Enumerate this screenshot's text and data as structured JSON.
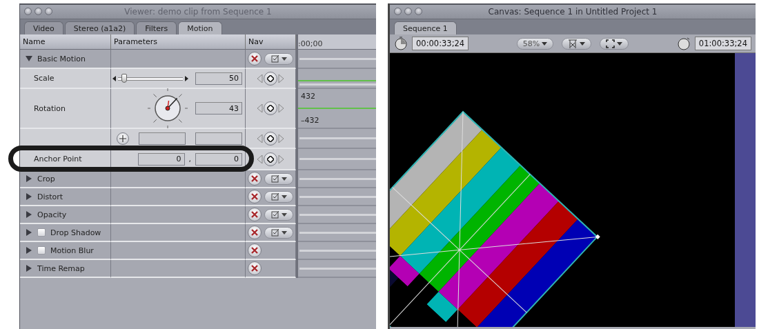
{
  "viewer": {
    "title": "Viewer: demo clip from Sequence 1",
    "tabs": [
      {
        "label": "Video",
        "selected": false
      },
      {
        "label": "Stereo (a1a2)",
        "selected": false
      },
      {
        "label": "Filters",
        "selected": false
      },
      {
        "label": "Motion",
        "selected": true
      }
    ],
    "columns": [
      "Name",
      "Parameters",
      "Nav"
    ],
    "timeline_start": ":00;00",
    "rows": [
      {
        "kind": "group",
        "label": "Basic Motion",
        "expanded": true,
        "menu": true
      },
      {
        "kind": "slider",
        "label": "Scale",
        "level": 0.1,
        "value": "50"
      },
      {
        "kind": "dial",
        "label": "Rotation",
        "value": "43",
        "graph_labels": [
          "432",
          "–432"
        ]
      },
      {
        "kind": "point",
        "crosshair": true
      },
      {
        "kind": "point",
        "label": "Anchor Point",
        "values": [
          "0",
          "0"
        ],
        "separator": ","
      },
      {
        "kind": "group",
        "label": "Crop",
        "expanded": false,
        "menu": true
      },
      {
        "kind": "group",
        "label": "Distort",
        "expanded": false,
        "menu": true
      },
      {
        "kind": "group",
        "label": "Opacity",
        "expanded": false,
        "menu": true
      },
      {
        "kind": "group",
        "label": "Drop Shadow",
        "expanded": false,
        "menu": true,
        "checked": false
      },
      {
        "kind": "group",
        "label": "Motion Blur",
        "expanded": false,
        "menu": false,
        "checked": false
      },
      {
        "kind": "group",
        "label": "Time Remap",
        "expanded": false,
        "menu": false
      }
    ]
  },
  "canvas": {
    "title": "Canvas: Sequence 1 in Untitled Project 1",
    "tabs": [
      {
        "label": "Sequence 1",
        "selected": true
      }
    ],
    "current_timecode": "00:00:33;24",
    "zoom": "58%",
    "duration_timecode": "01:00:33;24"
  }
}
